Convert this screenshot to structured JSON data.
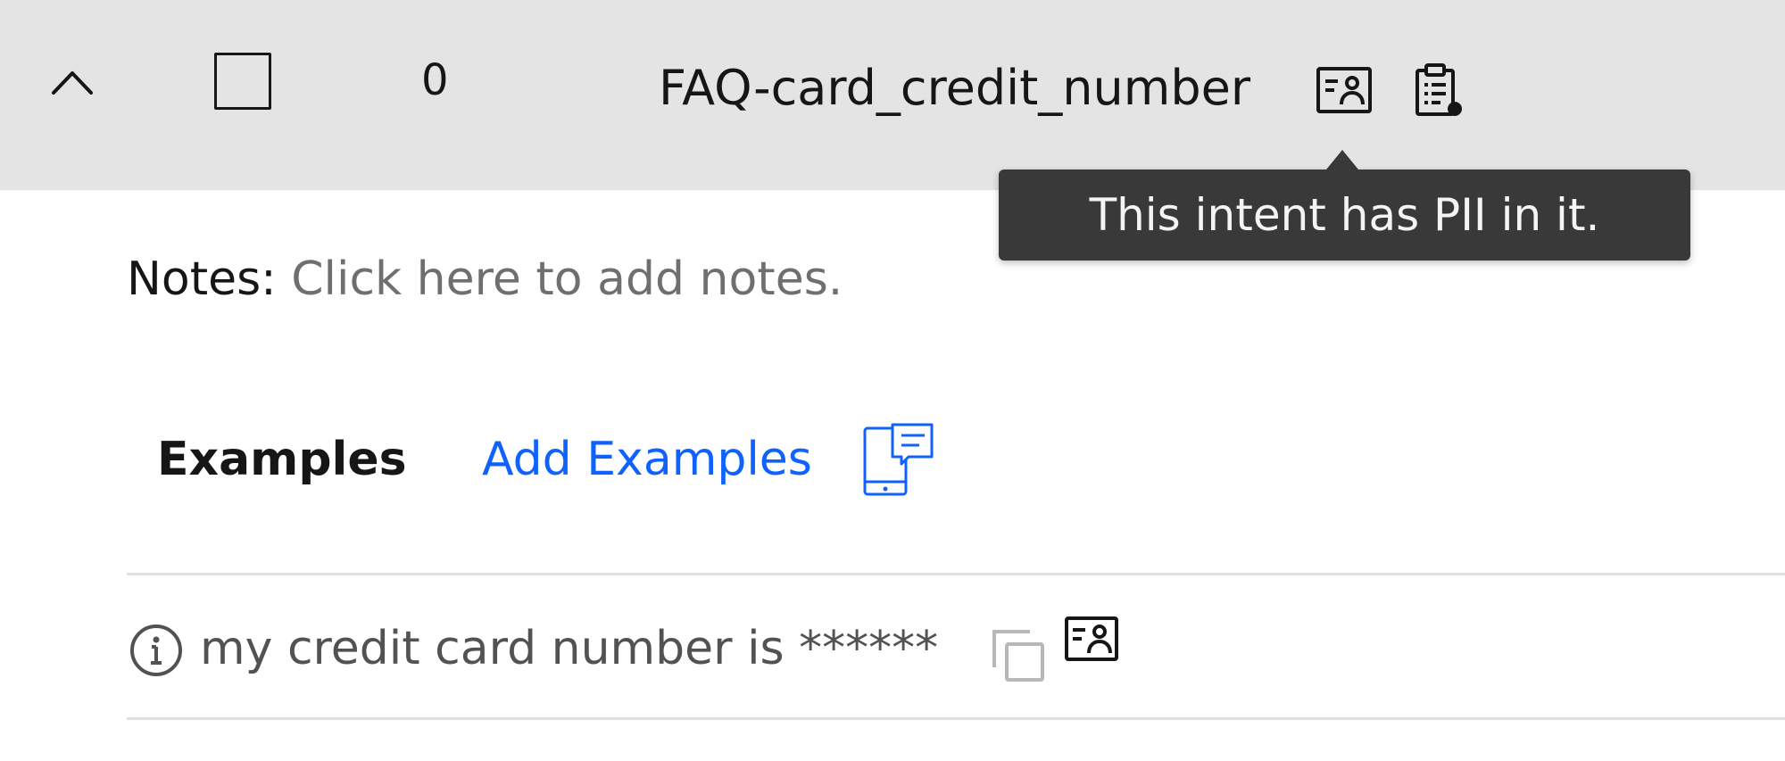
{
  "intent_row": {
    "count": "0",
    "name": "FAQ-card_credit_number",
    "icons": {
      "expand": "chevron-up-icon",
      "select": "checkbox-icon",
      "pii": "id-card-icon",
      "clipboard": "clipboard-notification-icon"
    }
  },
  "tooltip": {
    "text": "This intent has PII in it."
  },
  "notes": {
    "label": "Notes:",
    "placeholder": "Click here to add notes."
  },
  "examples": {
    "heading": "Examples",
    "add_label": "Add Examples",
    "add_icon": "mobile-chat-icon",
    "items": [
      {
        "text": "my credit card number is ******",
        "info_icon": "information-icon",
        "copy_icon": "copy-icon",
        "pii_icon": "id-card-icon"
      }
    ]
  },
  "colors": {
    "header_bg": "#e4e4e4",
    "tooltip_bg": "#393939",
    "link": "#0f62fe",
    "text": "#161616",
    "muted_text": "#6f6f6f",
    "divider": "#e0e0e0"
  }
}
